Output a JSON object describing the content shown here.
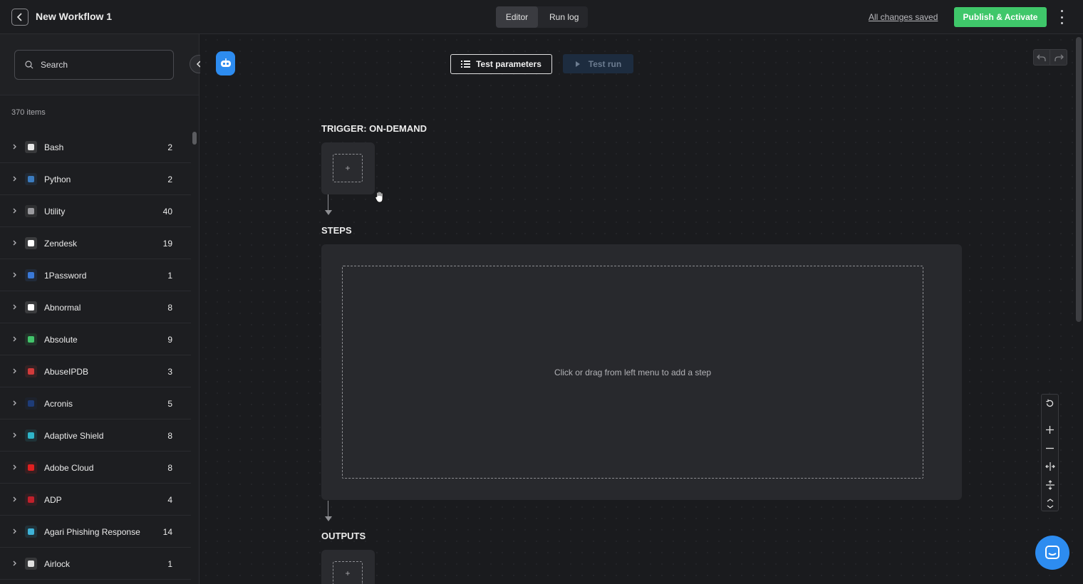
{
  "header": {
    "title": "New Workflow 1",
    "tabs": [
      {
        "label": "Editor",
        "active": true
      },
      {
        "label": "Run log",
        "active": false
      }
    ],
    "saved_status": "All changes saved",
    "publish_label": "Publish & Activate"
  },
  "sidebar": {
    "search_placeholder": "Search",
    "item_count": "370 items",
    "items": [
      {
        "name": "Bash",
        "count": "2",
        "icon": "bash-icon",
        "color": "#e8e8e8"
      },
      {
        "name": "Python",
        "count": "2",
        "icon": "python-icon",
        "color": "#3b7bbf"
      },
      {
        "name": "Utility",
        "count": "40",
        "icon": "wrench-icon",
        "color": "#9a9a9e"
      },
      {
        "name": "Zendesk",
        "count": "19",
        "icon": "zendesk-icon",
        "color": "#ffffff"
      },
      {
        "name": "1Password",
        "count": "1",
        "icon": "onepassword-icon",
        "color": "#3a79d8"
      },
      {
        "name": "Abnormal",
        "count": "8",
        "icon": "abnormal-icon",
        "color": "#ffffff"
      },
      {
        "name": "Absolute",
        "count": "9",
        "icon": "absolute-icon",
        "color": "#42c46b"
      },
      {
        "name": "AbuseIPDB",
        "count": "3",
        "icon": "abuseipdb-icon",
        "color": "#d23b3b"
      },
      {
        "name": "Acronis",
        "count": "5",
        "icon": "acronis-icon",
        "color": "#1e3c78"
      },
      {
        "name": "Adaptive Shield",
        "count": "8",
        "icon": "adaptive-shield-icon",
        "color": "#2fb5c9"
      },
      {
        "name": "Adobe Cloud",
        "count": "8",
        "icon": "adobe-icon",
        "color": "#e02020"
      },
      {
        "name": "ADP",
        "count": "4",
        "icon": "adp-icon",
        "color": "#c0202b"
      },
      {
        "name": "Agari Phishing Response",
        "count": "14",
        "icon": "agari-icon",
        "color": "#3fb3d8"
      },
      {
        "name": "Airlock",
        "count": "1",
        "icon": "airlock-icon",
        "color": "#e0e0e0"
      }
    ]
  },
  "toolbar": {
    "test_params_label": "Test parameters",
    "test_run_label": "Test run"
  },
  "canvas": {
    "trigger_label": "TRIGGER: ON-DEMAND",
    "steps_label": "STEPS",
    "steps_hint": "Click or drag from left menu to add a step",
    "outputs_label": "OUTPUTS",
    "add_symbol": "+"
  },
  "colors": {
    "accent_green": "#3fc76a",
    "accent_blue": "#2d8cf0",
    "background": "#1a1b1e"
  }
}
